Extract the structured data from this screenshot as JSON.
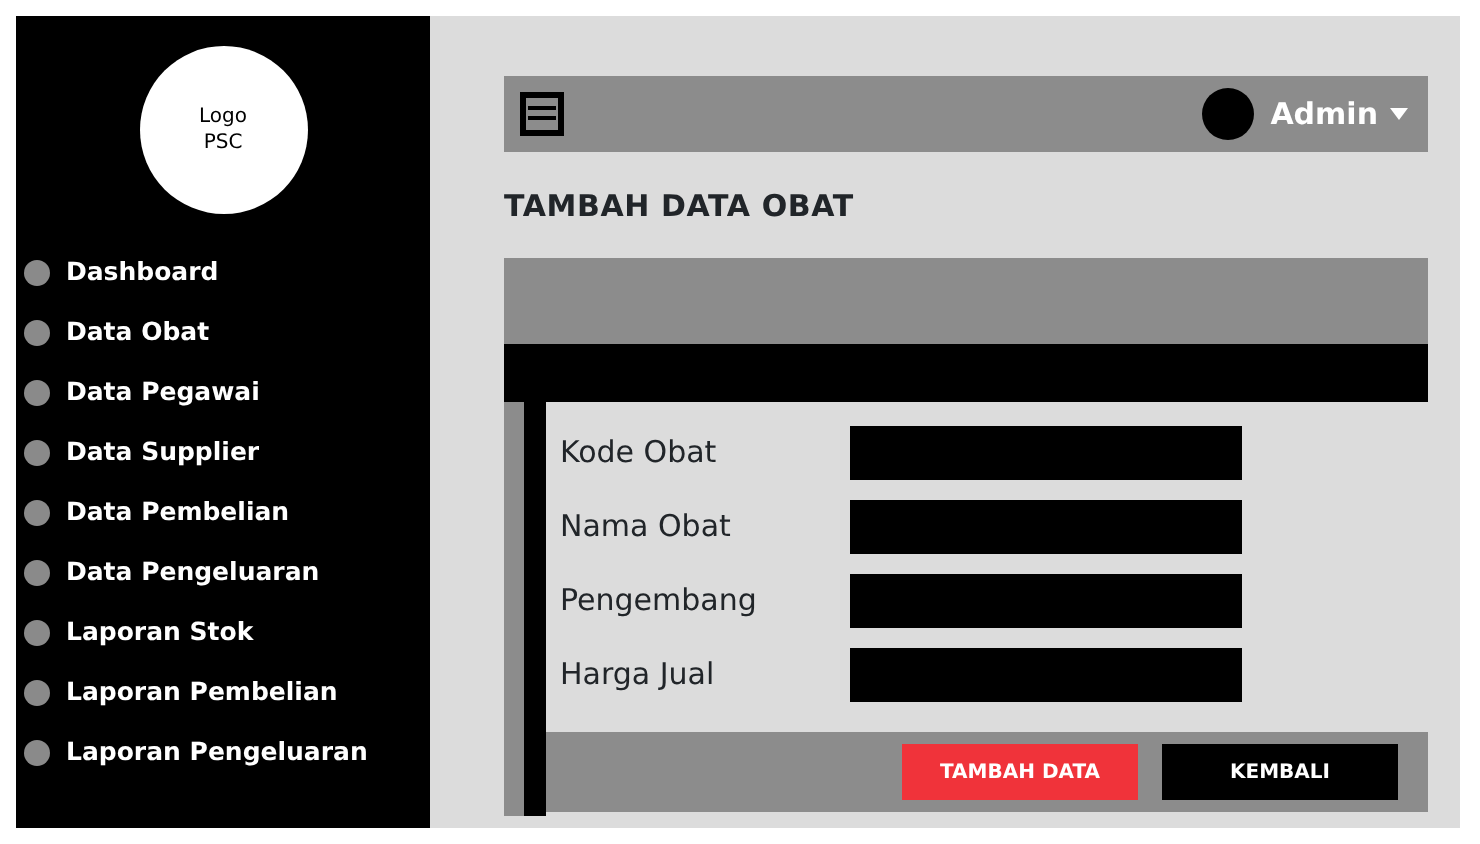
{
  "logo": {
    "lines": [
      "Logo",
      "PSC"
    ]
  },
  "sidebar": {
    "items": [
      {
        "label": "Dashboard"
      },
      {
        "label": "Data Obat"
      },
      {
        "label": "Data Pegawai"
      },
      {
        "label": "Data Supplier"
      },
      {
        "label": "Data Pembelian"
      },
      {
        "label": "Data Pengeluaran"
      },
      {
        "label": "Laporan Stok"
      },
      {
        "label": "Laporan Pembelian"
      },
      {
        "label": "Laporan Pengeluaran"
      }
    ]
  },
  "topbar": {
    "user": "Admin"
  },
  "page_title": "TAMBAH DATA OBAT",
  "form": {
    "fields": [
      {
        "label": "Kode Obat"
      },
      {
        "label": "Nama Obat"
      },
      {
        "label": "Pengembang"
      },
      {
        "label": "Harga Jual"
      }
    ],
    "buttons": [
      {
        "label": "TAMBAH DATA",
        "kind": "primary"
      },
      {
        "label": "KEMBALI",
        "kind": "secondary"
      }
    ]
  }
}
